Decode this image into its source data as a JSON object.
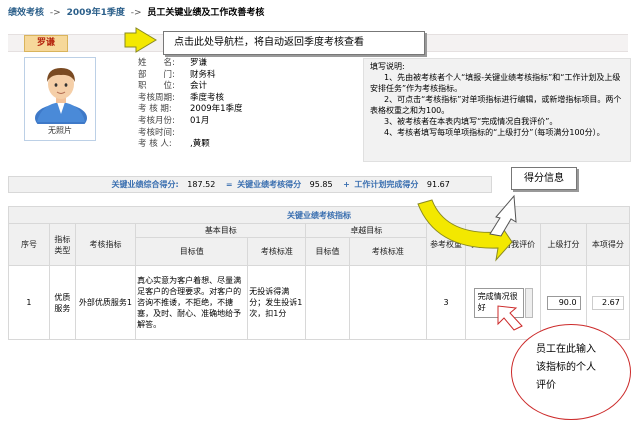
{
  "breadcrumb": {
    "root": "绩效考核",
    "sep1": "->",
    "quarter": "2009年1季度",
    "sep2": "->",
    "current": "员工关键业绩及工作改善考核"
  },
  "employee": {
    "name_tab": "罗谦",
    "no_photo": "无照片",
    "fields": [
      {
        "label": "姓　　名:",
        "value": "罗谦"
      },
      {
        "label": "部　　门:",
        "value": "财务科"
      },
      {
        "label": "职　　位:",
        "value": "会计"
      },
      {
        "label": "考核周期:",
        "value": "季度考核"
      },
      {
        "label": "考 核 期:",
        "value": "2009年1季度"
      },
      {
        "label": "考核月份:",
        "value": "01月"
      },
      {
        "label": "考核时间:",
        "value": ""
      },
      {
        "label": "考 核 人:",
        "value": ",黄颗"
      }
    ]
  },
  "instructions": {
    "title": "填写说明:",
    "lines": [
      "1、先由被考核者个人“填报-关键业绩考核指标”和“工作计划及上级安排任务”作为考核指标。",
      "2、可点击“考核指标”对单项指标进行编辑，或新增指标项目。两个表格权重之和为100。",
      "3、被考核者在本表内填写“完成情况自我评价”。",
      "4、考核者填写每项单项指标的“上级打分”（每项满分100分）。"
    ]
  },
  "callouts": {
    "nav": "点击此处导航栏，将自动返回季度考核查看",
    "score": "得分信息",
    "input": [
      "员工在此输入",
      "该指标的个人",
      "评价"
    ]
  },
  "scores": {
    "total_label": "关键业绩综合得分:",
    "total_value": "187.52",
    "eq": "=",
    "kpi_label": "关键业绩考核得分",
    "kpi_value": "95.85",
    "plus": "+",
    "plan_label": "工作计划完成得分",
    "plan_value": "91.67"
  },
  "table": {
    "caption": "关键业绩考核指标",
    "headers": {
      "seq": "序号",
      "type": "指标类型",
      "indicator": "考核指标",
      "basic_goal": "基本目标",
      "goal": "目标值",
      "standard": "考核标准",
      "excellent_goal": "卓越目标",
      "ex_goal": "目标值",
      "ex_standard": "考核标准",
      "weight": "参考权重",
      "self_eval": "完成情况自我评价",
      "superior": "上级打分",
      "score": "本项得分"
    },
    "rows": [
      {
        "seq": "1",
        "type": "优质服务",
        "indicator": "外部优质服务1",
        "goal": "真心实意为客户着想、尽量满足客户的合理要求。对客户的咨询不推诿，不拒绝，不搪塞，及时、耐心、准确地给予解答。",
        "standard": "无投诉得满分；发生投诉1次，扣1分",
        "ex_goal": "",
        "ex_standard": "",
        "weight": "3",
        "self_eval": "完成情况很好",
        "superior": "90.0",
        "score": "2.67"
      }
    ]
  },
  "colors": {
    "link_blue": "#2b5f8a",
    "accent_blue": "#3a6fb0",
    "tab_red": "#b5250f",
    "arrow_yellow": "#f3e800",
    "ellipse_red": "#cc2a2a"
  }
}
